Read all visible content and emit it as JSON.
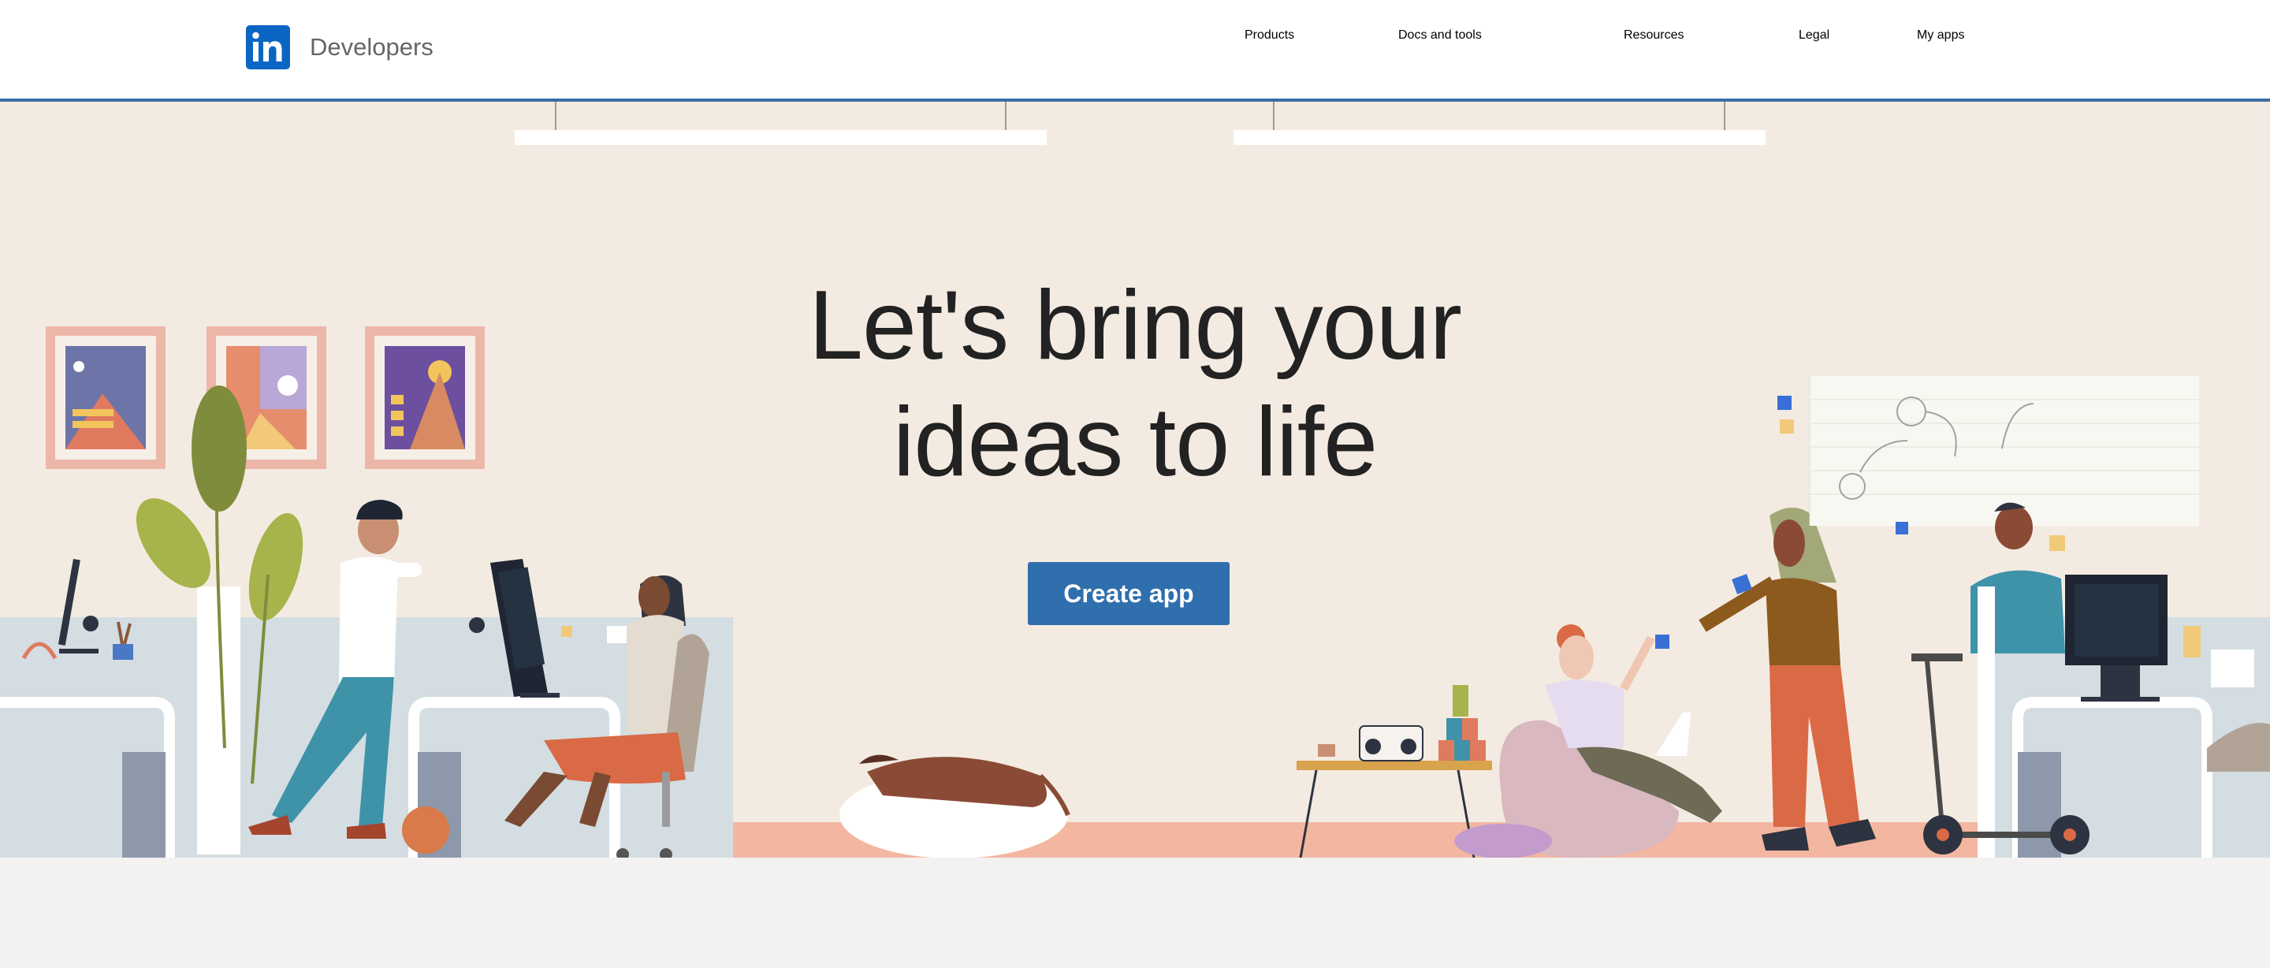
{
  "header": {
    "logo_icon": "linkedin-logo-icon",
    "brand": "Developers",
    "nav": [
      {
        "label": "Products"
      },
      {
        "label": "Docs and tools"
      },
      {
        "label": "Resources"
      },
      {
        "label": "Legal"
      },
      {
        "label": "My apps"
      }
    ]
  },
  "hero": {
    "headline_line1": "Let's bring your",
    "headline_line2": "ideas to life",
    "cta_label": "Create app",
    "illustration": "office-workspace-illustration"
  },
  "colors": {
    "accent": "#2f6fad",
    "brand_blue": "#0a66c2",
    "hero_bg": "#f3ebe1",
    "nav_text": "#2b6cb0",
    "floor": "#f3b6a0"
  }
}
